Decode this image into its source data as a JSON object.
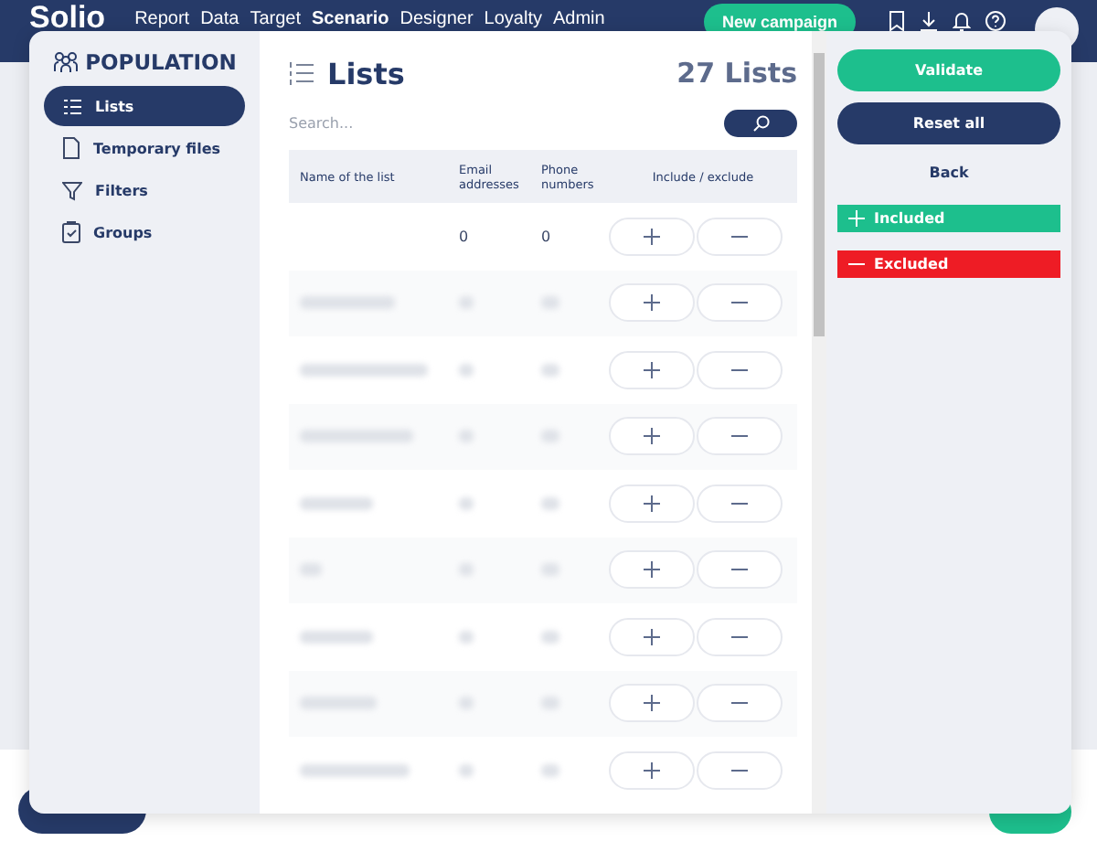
{
  "app_header": {
    "logo": "Solio",
    "nav": [
      {
        "label": "Report",
        "selected": false
      },
      {
        "label": "Data",
        "selected": false
      },
      {
        "label": "Target",
        "selected": false
      },
      {
        "label": "Scenario",
        "selected": true
      },
      {
        "label": "Designer",
        "selected": false
      },
      {
        "label": "Loyalty",
        "selected": false
      },
      {
        "label": "Admin",
        "selected": false
      }
    ],
    "new_button": "New campaign"
  },
  "sidebar": {
    "title": "POPULATION",
    "items": [
      {
        "label": "Lists",
        "kind": "list",
        "selected": true
      },
      {
        "label": "Temporary files",
        "kind": "file",
        "selected": false
      },
      {
        "label": "Filters",
        "kind": "filter",
        "selected": false
      },
      {
        "label": "Groups",
        "kind": "group",
        "selected": false
      }
    ]
  },
  "main": {
    "title": "Lists",
    "count": "27 Lists",
    "search": {
      "placeholder": "Search..."
    },
    "table": {
      "columns": [
        "Name of the list",
        "Email addresses",
        "Phone numbers",
        "Include / exclude"
      ],
      "rows": [
        {
          "kind": "plain",
          "name": "",
          "email": "0",
          "phone": "0"
        },
        {
          "kind": "blurred"
        },
        {
          "kind": "blurred"
        },
        {
          "kind": "blurred"
        },
        {
          "kind": "blurred"
        },
        {
          "kind": "blurred"
        },
        {
          "kind": "blurred"
        },
        {
          "kind": "blurred"
        },
        {
          "kind": "blurred"
        }
      ]
    }
  },
  "actions": {
    "validate": "Validate",
    "reset": "Reset all",
    "back": "Back"
  },
  "legend": [
    {
      "kind": "include",
      "label": "Included",
      "color": "#1dbf8d"
    },
    {
      "kind": "exclude",
      "label": "Excluded",
      "color": "#ee1c25"
    }
  ]
}
